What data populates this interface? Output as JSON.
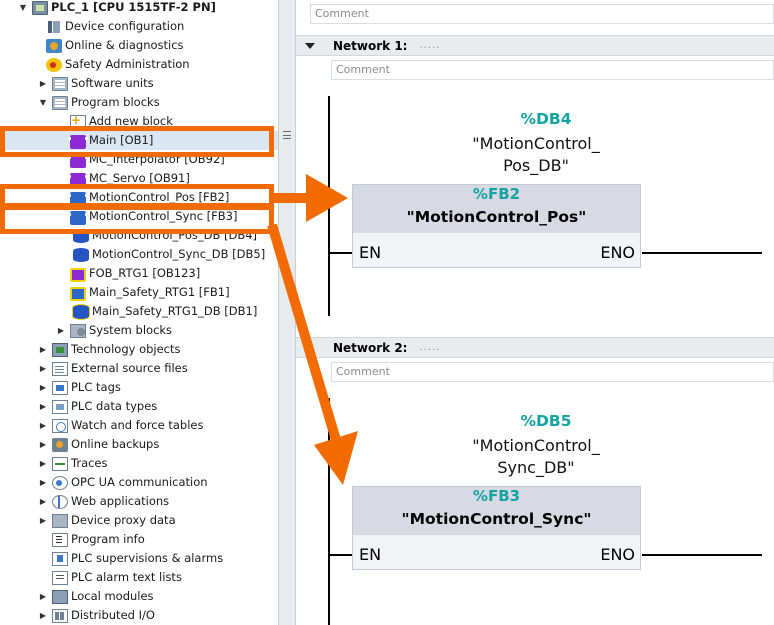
{
  "colors": {
    "annotation": "#f26b00",
    "operand": "#14a3a3",
    "selection": "#dbe6f3"
  },
  "tree": {
    "items": [
      {
        "label": "PLC_1 [CPU 1515TF-2 PN]",
        "icon": "plc-icon",
        "expander": "▼"
      },
      {
        "label": "Device configuration",
        "icon": "device-config-icon",
        "expander": ""
      },
      {
        "label": "Online & diagnostics",
        "icon": "online-diagnostics-icon",
        "expander": ""
      },
      {
        "label": "Safety Administration",
        "icon": "safety-icon",
        "expander": ""
      },
      {
        "label": "Software units",
        "icon": "folder-icon",
        "expander": "▶"
      },
      {
        "label": "Program blocks",
        "icon": "folder-icon",
        "expander": "▼"
      },
      {
        "label": "Add new block",
        "icon": "add-block-icon",
        "expander": ""
      },
      {
        "label": "Main [OB1]",
        "icon": "ob-icon",
        "expander": ""
      },
      {
        "label": "MC_Interpolator [OB92]",
        "icon": "ob-icon",
        "expander": ""
      },
      {
        "label": "MC_Servo [OB91]",
        "icon": "ob-icon",
        "expander": ""
      },
      {
        "label": "MotionControl_Pos [FB2]",
        "icon": "fb-icon",
        "expander": ""
      },
      {
        "label": "MotionControl_Sync [FB3]",
        "icon": "fb-icon",
        "expander": ""
      },
      {
        "label": "MotionControl_Pos_DB [DB4]",
        "icon": "db-icon",
        "expander": ""
      },
      {
        "label": "MotionControl_Sync_DB [DB5]",
        "icon": "db-icon",
        "expander": ""
      },
      {
        "label": "FOB_RTG1 [OB123]",
        "icon": "safety-ob-icon",
        "expander": ""
      },
      {
        "label": "Main_Safety_RTG1 [FB1]",
        "icon": "safety-fb-icon",
        "expander": ""
      },
      {
        "label": "Main_Safety_RTG1_DB [DB1]",
        "icon": "safety-db-icon",
        "expander": ""
      },
      {
        "label": "System blocks",
        "icon": "system-blocks-icon",
        "expander": "▶"
      },
      {
        "label": "Technology objects",
        "icon": "technology-objects-icon",
        "expander": "▶"
      },
      {
        "label": "External source files",
        "icon": "external-source-icon",
        "expander": "▶"
      },
      {
        "label": "PLC tags",
        "icon": "plc-tags-icon",
        "expander": "▶"
      },
      {
        "label": "PLC data types",
        "icon": "plc-data-types-icon",
        "expander": "▶"
      },
      {
        "label": "Watch and force tables",
        "icon": "watch-tables-icon",
        "expander": "▶"
      },
      {
        "label": "Online backups",
        "icon": "online-backups-icon",
        "expander": "▶"
      },
      {
        "label": "Traces",
        "icon": "traces-icon",
        "expander": "▶"
      },
      {
        "label": "OPC UA communication",
        "icon": "opc-ua-icon",
        "expander": "▶"
      },
      {
        "label": "Web applications",
        "icon": "web-applications-icon",
        "expander": "▶"
      },
      {
        "label": "Device proxy data",
        "icon": "device-proxy-icon",
        "expander": "▶"
      },
      {
        "label": "Program info",
        "icon": "program-info-icon",
        "expander": ""
      },
      {
        "label": "PLC supervisions & alarms",
        "icon": "plc-alarms-icon",
        "expander": ""
      },
      {
        "label": "PLC alarm text lists",
        "icon": "alarm-text-lists-icon",
        "expander": ""
      },
      {
        "label": "Local modules",
        "icon": "local-modules-icon",
        "expander": "▶"
      },
      {
        "label": "Distributed I/O",
        "icon": "distributed-io-icon",
        "expander": "▶"
      }
    ]
  },
  "editor": {
    "block_comment": "Comment",
    "networks": [
      {
        "label": "Network 1:",
        "dots": ".....",
        "comment": "Comment",
        "instance_db": "%DB4",
        "instance_name": "\"MotionControl_ Pos_DB\"",
        "fb_type": "%FB2",
        "fb_name": "\"MotionControl_Pos\"",
        "en": "EN",
        "eno": "ENO"
      },
      {
        "label": "Network 2:",
        "dots": ".....",
        "comment": "Comment",
        "instance_db": "%DB5",
        "instance_name": "\"MotionControl_ Sync_DB\"",
        "fb_type": "%FB3",
        "fb_name": "\"MotionControl_Sync\"",
        "en": "EN",
        "eno": "ENO"
      }
    ]
  }
}
